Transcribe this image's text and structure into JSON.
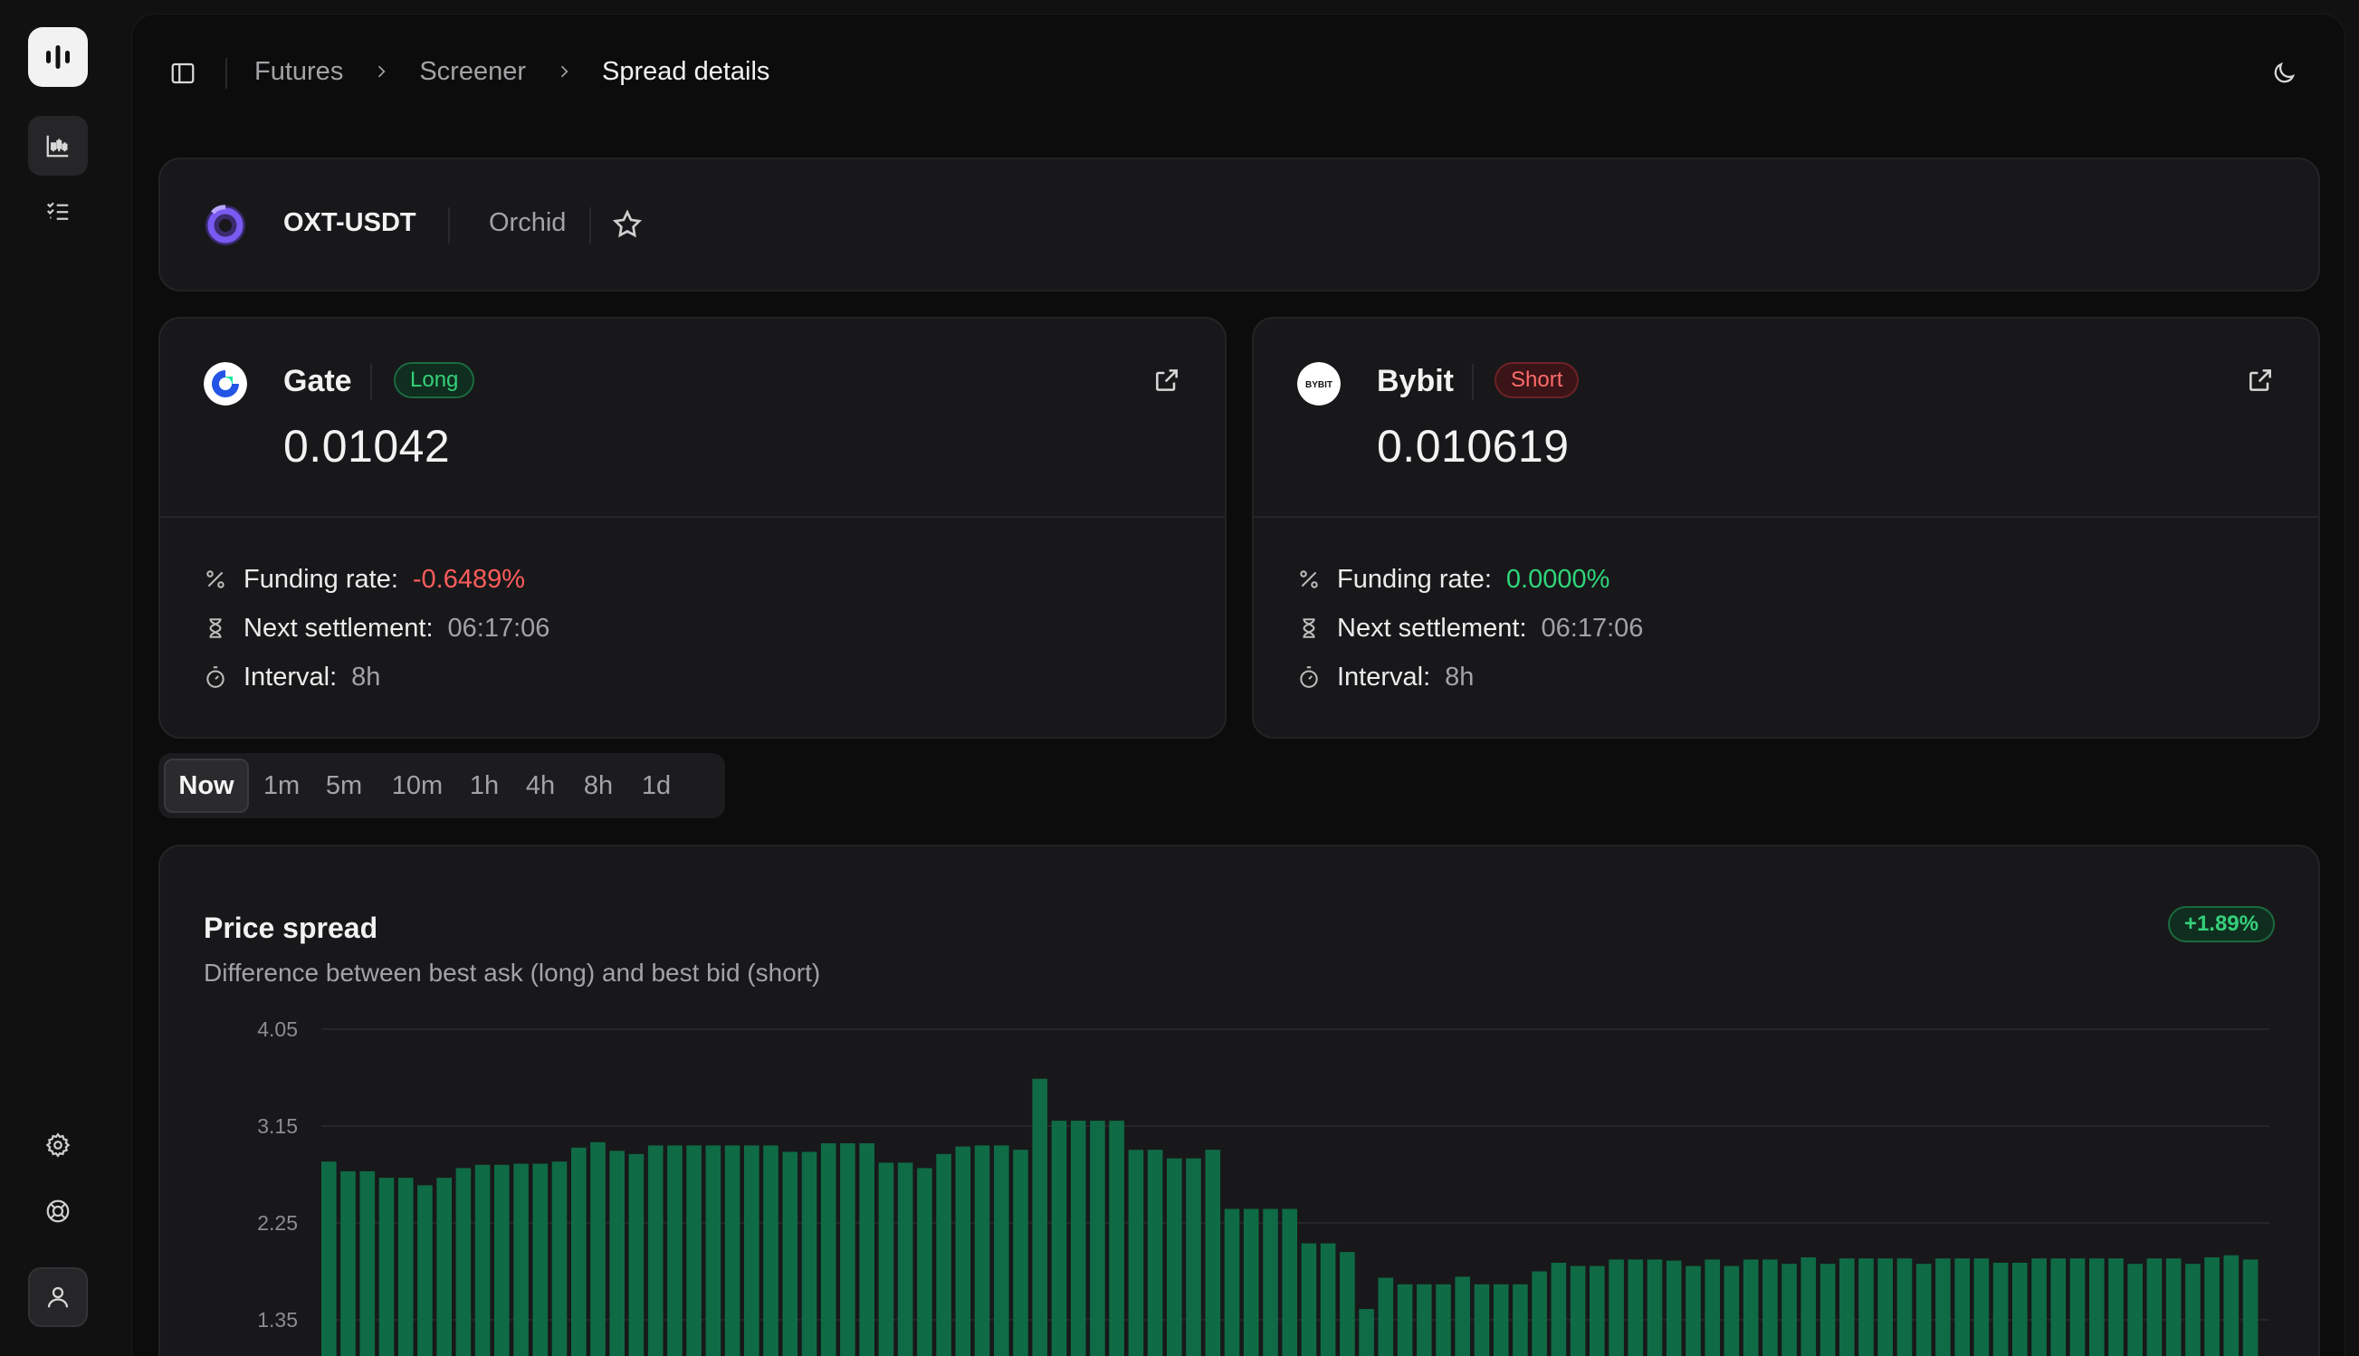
{
  "rail": {
    "nav": [
      {
        "name": "screener-icon",
        "active": true
      },
      {
        "name": "checklist-icon",
        "active": false
      }
    ],
    "bottom": [
      "settings-icon",
      "help-icon",
      "user-icon"
    ]
  },
  "breadcrumb": [
    "Futures",
    "Screener",
    "Spread details"
  ],
  "pair": {
    "symbol": "OXT-USDT",
    "name": "Orchid"
  },
  "exchanges": [
    {
      "name": "Gate",
      "side": "Long",
      "price": "0.01042",
      "funding_label": "Funding rate:",
      "funding": "-0.6489%",
      "funding_sign": "neg",
      "settlement_label": "Next settlement:",
      "settlement": "06:17:06",
      "interval_label": "Interval:",
      "interval": "8h"
    },
    {
      "name": "Bybit",
      "side": "Short",
      "price": "0.010619",
      "funding_label": "Funding rate:",
      "funding": "0.0000%",
      "funding_sign": "pos",
      "settlement_label": "Next settlement:",
      "settlement": "06:17:06",
      "interval_label": "Interval:",
      "interval": "8h"
    }
  ],
  "bybit_logo_text": "BYBIT",
  "timeframes": [
    "Now",
    "1m",
    "5m",
    "10m",
    "1h",
    "4h",
    "8h",
    "1d"
  ],
  "timeframe_active": "Now",
  "chart": {
    "title": "Price spread",
    "subtitle": "Difference between best ask (long) and best bid (short)",
    "delta": "+1.89%"
  },
  "chart_data": {
    "type": "bar",
    "ylim": [
      1.2,
      4.05
    ],
    "yticks": [
      4.05,
      3.15,
      2.25,
      1.35
    ],
    "grid": true,
    "color": "#0f6b45",
    "values": [
      2.82,
      2.73,
      2.73,
      2.67,
      2.67,
      2.6,
      2.67,
      2.76,
      2.79,
      2.79,
      2.8,
      2.8,
      2.82,
      2.95,
      3.0,
      2.92,
      2.89,
      2.97,
      2.97,
      2.97,
      2.97,
      2.97,
      2.97,
      2.97,
      2.91,
      2.91,
      2.99,
      2.99,
      2.99,
      2.81,
      2.81,
      2.76,
      2.89,
      2.96,
      2.97,
      2.97,
      2.93,
      3.59,
      3.2,
      3.2,
      3.2,
      3.2,
      2.93,
      2.93,
      2.85,
      2.85,
      2.93,
      2.38,
      2.38,
      2.38,
      2.38,
      2.06,
      2.06,
      1.98,
      1.45,
      1.74,
      1.68,
      1.68,
      1.68,
      1.75,
      1.68,
      1.68,
      1.68,
      1.8,
      1.88,
      1.85,
      1.85,
      1.91,
      1.91,
      1.91,
      1.9,
      1.85,
      1.91,
      1.85,
      1.91,
      1.91,
      1.87,
      1.93,
      1.87,
      1.92,
      1.92,
      1.92,
      1.92,
      1.87,
      1.92,
      1.92,
      1.92,
      1.88,
      1.88,
      1.92,
      1.92,
      1.92,
      1.92,
      1.92,
      1.87,
      1.92,
      1.92,
      1.87,
      1.93,
      1.95,
      1.91
    ]
  },
  "colors": {
    "accent_green": "#2fd67a",
    "accent_red": "#ff5c5c",
    "bar": "#0f6b45"
  }
}
